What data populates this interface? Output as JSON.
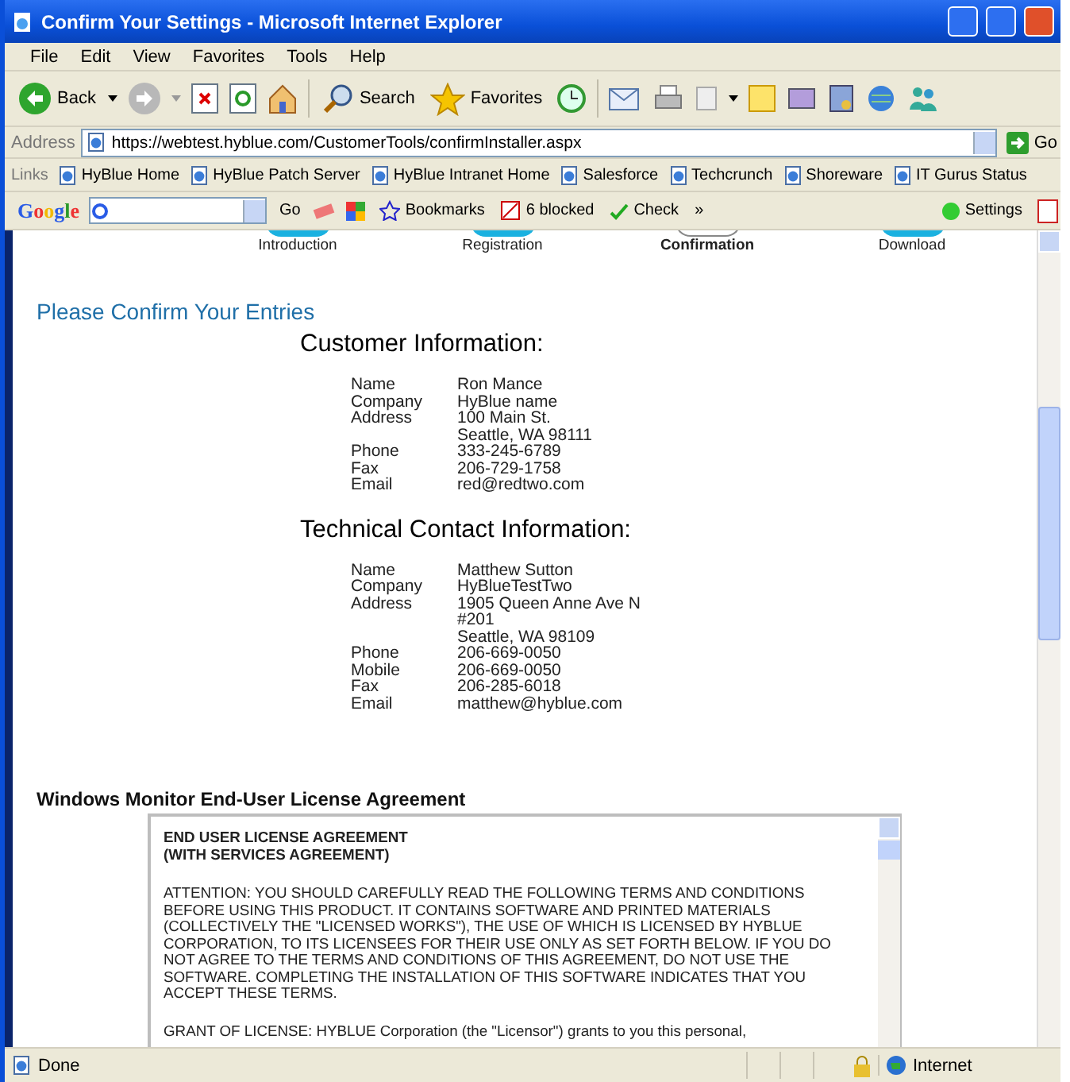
{
  "window": {
    "title": "Confirm Your Settings - Microsoft Internet Explorer"
  },
  "menu": [
    "File",
    "Edit",
    "View",
    "Favorites",
    "Tools",
    "Help"
  ],
  "toolbar": {
    "back": "Back",
    "search": "Search",
    "favorites": "Favorites"
  },
  "address": {
    "label": "Address",
    "url": "https://webtest.hyblue.com/CustomerTools/confirmInstaller.aspx",
    "go": "Go"
  },
  "links": {
    "label": "Links",
    "items": [
      "HyBlue Home",
      "HyBlue Patch Server",
      "HyBlue Intranet Home",
      "Salesforce",
      "Techcrunch",
      "Shoreware",
      "IT Gurus Status"
    ]
  },
  "google_bar": {
    "logo": "Google",
    "go": "Go",
    "bookmarks": "Bookmarks",
    "blocked": "6 blocked",
    "check": "Check",
    "more": "»",
    "settings": "Settings"
  },
  "steps": [
    {
      "label": "Introduction",
      "selected": false
    },
    {
      "label": "Registration",
      "selected": false
    },
    {
      "label": "Confirmation",
      "selected": true
    },
    {
      "label": "Download",
      "selected": false
    }
  ],
  "page_title": "Please Confirm Your Entries",
  "sections": [
    {
      "heading": "Customer Information:",
      "rows": [
        {
          "label": "Name",
          "value": [
            "Ron Mance"
          ]
        },
        {
          "label": "Company",
          "value": [
            "HyBlue name"
          ]
        },
        {
          "label": "Address",
          "value": [
            "100 Main St.",
            "Seattle, WA 98111"
          ]
        },
        {
          "label": "Phone",
          "value": [
            "333-245-6789"
          ]
        },
        {
          "label": "Fax",
          "value": [
            "206-729-1758"
          ]
        },
        {
          "label": "Email",
          "value": [
            "red@redtwo.com"
          ]
        }
      ]
    },
    {
      "heading": "Technical Contact Information:",
      "rows": [
        {
          "label": "Name",
          "value": [
            "Matthew Sutton"
          ]
        },
        {
          "label": "Company",
          "value": [
            "HyBlueTestTwo"
          ]
        },
        {
          "label": "Address",
          "value": [
            "1905 Queen Anne Ave N",
            "#201",
            "Seattle, WA 98109"
          ]
        },
        {
          "label": "Phone",
          "value": [
            "206-669-0050"
          ]
        },
        {
          "label": "Mobile",
          "value": [
            "206-669-0050"
          ]
        },
        {
          "label": "Fax",
          "value": [
            "206-285-6018"
          ]
        },
        {
          "label": "Email",
          "value": [
            "matthew@hyblue.com"
          ]
        }
      ]
    }
  ],
  "license": {
    "heading": "Windows Monitor End-User License Agreement",
    "title": [
      "END USER LICENSE AGREEMENT",
      "(WITH SERVICES AGREEMENT)"
    ],
    "paragraphs": [
      "ATTENTION: YOU SHOULD CAREFULLY READ THE FOLLOWING TERMS AND CONDITIONS BEFORE USING THIS PRODUCT. IT CONTAINS SOFTWARE AND PRINTED MATERIALS (COLLECTIVELY THE \"LICENSED WORKS\"), THE USE OF WHICH IS LICENSED BY HYBLUE CORPORATION, TO ITS LICENSEES FOR THEIR USE ONLY AS SET FORTH BELOW. IF YOU DO NOT AGREE TO THE TERMS AND CONDITIONS OF THIS AGREEMENT, DO NOT USE THE SOFTWARE. COMPLETING THE INSTALLATION OF THIS SOFTWARE INDICATES THAT YOU ACCEPT THESE TERMS.",
      "GRANT OF LICENSE: HYBLUE Corporation (the \"Licensor\") grants to you this personal,"
    ]
  },
  "status_bar": {
    "status": "Done",
    "zone": "Internet"
  }
}
